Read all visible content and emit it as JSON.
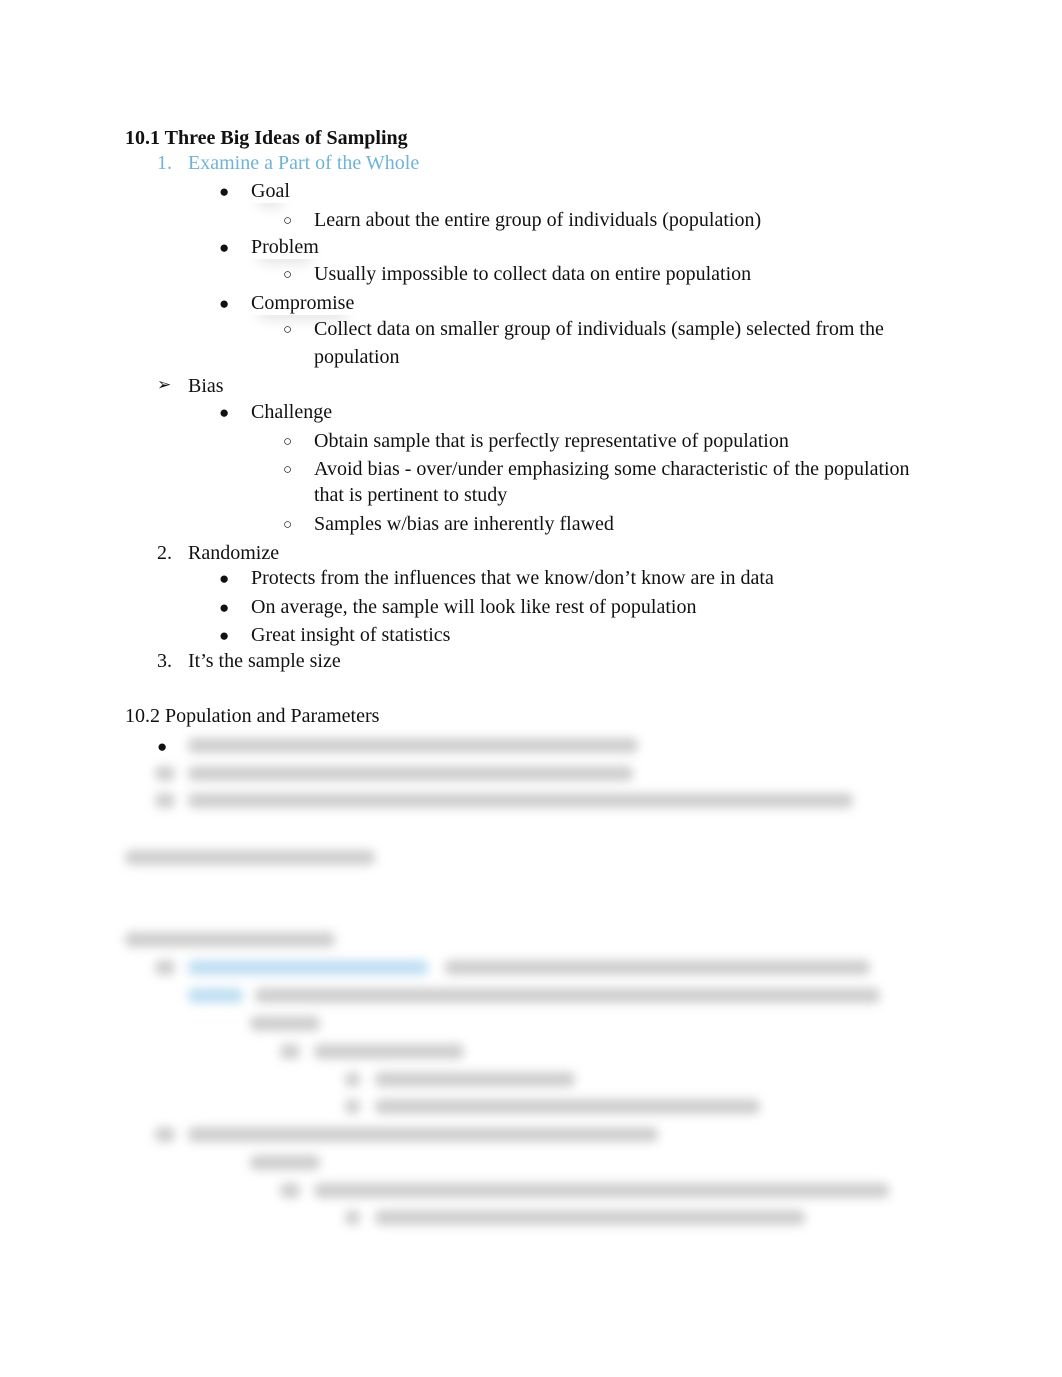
{
  "section1": {
    "title": "10.1 Three Big Ideas of Sampling",
    "idea1": {
      "marker": "1.",
      "label": "Examine a Part of the Whole"
    },
    "goal": {
      "label": "Goal",
      "sub": "Learn about the entire group of individuals (population)"
    },
    "problem": {
      "label": "Problem",
      "sub": "Usually impossible to collect data on entire population"
    },
    "compromise": {
      "label": "Compromise",
      "sub1": "Collect data on smaller group of individuals (sample) selected from the",
      "sub2": "population"
    },
    "bias": {
      "marker": "➢",
      "label": "Bias",
      "challenge": "Challenge",
      "items": [
        "Obtain sample that is perfectly representative of population",
        "Avoid bias - over/under emphasizing some characteristic of the population",
        "that is pertinent to study",
        "Samples w/bias are inherently flawed"
      ]
    },
    "idea2": {
      "marker": "2.",
      "label": "Randomize",
      "items": [
        "Protects from the influences that we know/don’t know are in data",
        "On average, the sample will look like rest of population",
        "Great insight of statistics"
      ]
    },
    "idea3": {
      "marker": "3.",
      "label": "It’s the sample size"
    }
  },
  "section2": {
    "title": "10.2 Population and Parameters"
  },
  "markers": {
    "bullet": "●",
    "circle": "○"
  }
}
